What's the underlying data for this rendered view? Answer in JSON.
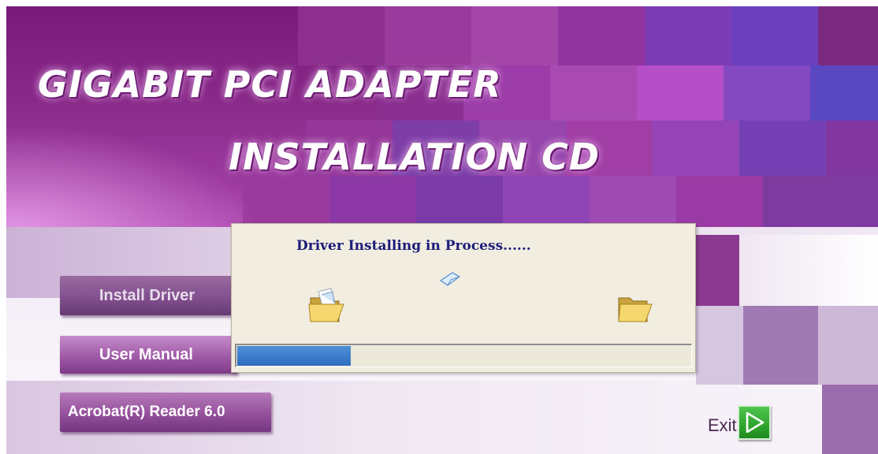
{
  "window": {
    "title_line1": "GIGABIT PCI ADAPTER",
    "title_line2": "INSTALLATION CD"
  },
  "menu": {
    "install_driver": "Install Driver",
    "user_manual": "User Manual",
    "acrobat_reader": "Acrobat(R) Reader 6.0"
  },
  "exit": {
    "label": "Exit",
    "icon": "play-arrow-icon"
  },
  "dialog": {
    "message": "Driver Installing in Process......",
    "progress_percent": 25,
    "icons": [
      "folder-source-icon",
      "flying-document-icon",
      "folder-dest-icon"
    ]
  },
  "colors": {
    "banner_purple": "#8a2a8a",
    "button_purple": "#8a4690",
    "dialog_bg": "#f1ede0",
    "message_text": "#1c1c7a",
    "progress_blue": "#2e6cc0",
    "exit_green": "#2fa52f"
  }
}
